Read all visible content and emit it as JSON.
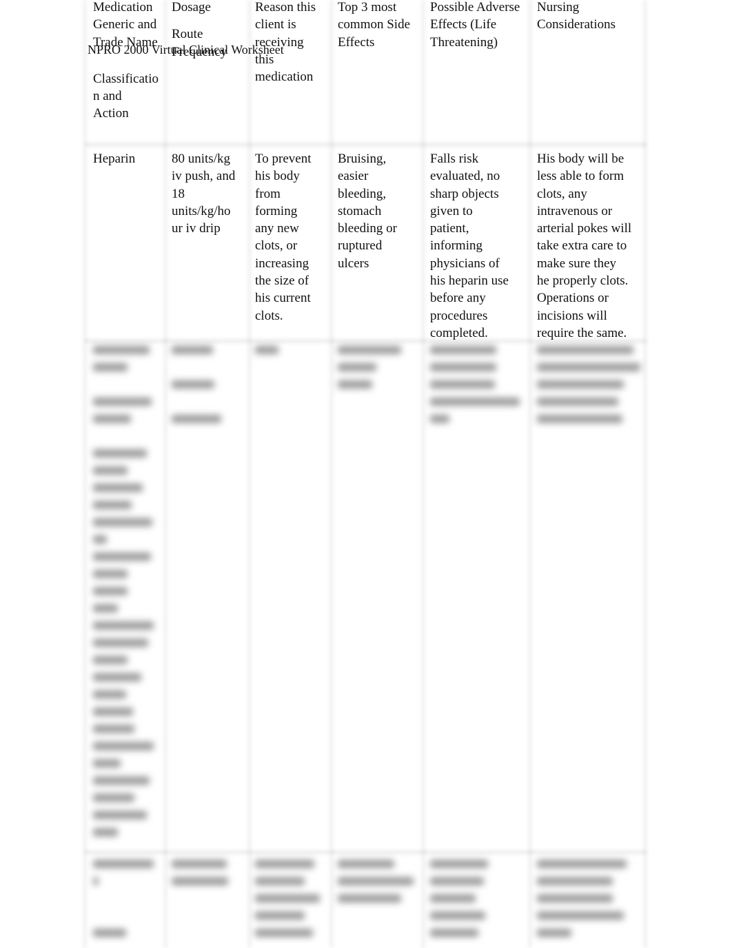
{
  "document": {
    "title": "NPRO 2000 Virtual Clinical Worksheet"
  },
  "table": {
    "headers": {
      "medication": [
        "Medication",
        "Generic and",
        "Trade Name",
        "",
        "",
        "Classificatio",
        "n and",
        "Action"
      ],
      "dosage": [
        "Dosage",
        "",
        "Route",
        "Frequency"
      ],
      "reason": [
        "Reason this",
        "client is",
        "receiving",
        "this",
        "medication"
      ],
      "side_effects": [
        "Top 3 most",
        "common Side",
        "Effects"
      ],
      "adverse_effects": [
        "Possible Adverse",
        "Effects (Life",
        "Threatening)"
      ],
      "nursing": [
        "Nursing",
        "Considerations"
      ]
    },
    "rows": [
      {
        "medication": "Heparin",
        "dosage": [
          "80 units/kg",
          "iv push, and",
          "18",
          "units/kg/ho",
          "ur iv drip"
        ],
        "reason": [
          "To prevent",
          "his body",
          "from",
          "forming",
          "any new",
          "clots, or",
          "increasing",
          "the size of",
          "his current",
          "clots."
        ],
        "side_effects": [
          "Bruising,",
          "easier",
          "bleeding,",
          "stomach",
          "bleeding or",
          "ruptured",
          "ulcers"
        ],
        "adverse_effects": [
          "Falls risk",
          "evaluated, no",
          "sharp objects",
          "given to",
          "patient,",
          "informing",
          "physicians of",
          "his heparin use",
          "before any",
          "procedures",
          "completed."
        ],
        "nursing": [
          "His body will be",
          "less able to form",
          "clots, any",
          "intravenous or",
          "arterial pokes will",
          "take extra care to",
          "make sure they",
          "he properly clots.",
          "Operations or",
          "incisions will",
          "require the same."
        ]
      }
    ],
    "blurred_rows_note": "content obscured"
  }
}
